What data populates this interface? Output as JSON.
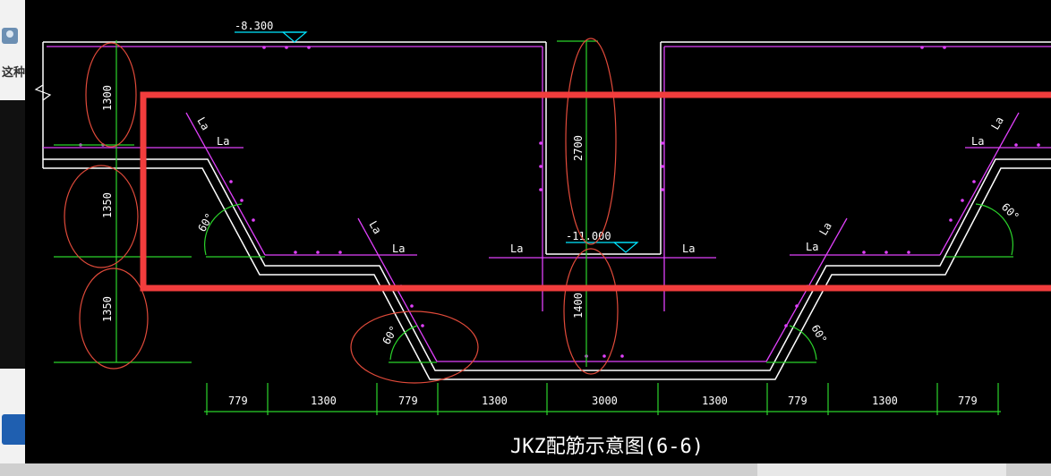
{
  "sidebar": {
    "text": "这种"
  },
  "diagram": {
    "title": "JKZ配筋示意图(6-6)",
    "elev_top": "-8.300",
    "elev_mid": "-11.000",
    "anchor_label": "La",
    "angle_label": "60°",
    "vert_dims": [
      "1300",
      "1350",
      "1350"
    ],
    "col_dims": [
      "2700",
      "1400"
    ],
    "bottom_dims": [
      "779",
      "1300",
      "779",
      "1300",
      "3000",
      "1300",
      "779",
      "1300",
      "779"
    ]
  }
}
